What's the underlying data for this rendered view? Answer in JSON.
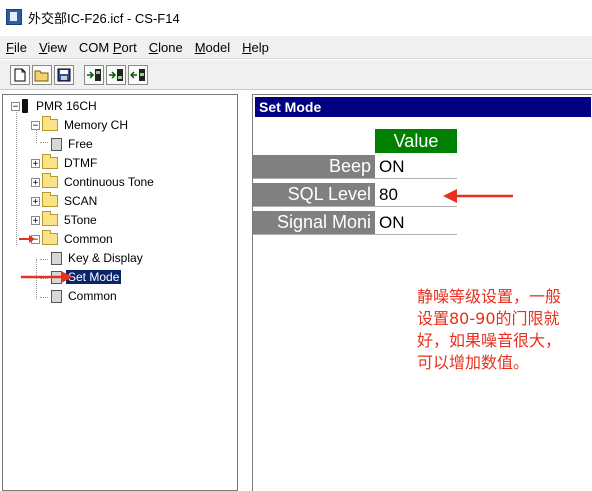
{
  "window": {
    "title": "外交部IC-F26.icf - CS-F14"
  },
  "menubar": {
    "items": [
      {
        "accel": "F",
        "rest": "ile"
      },
      {
        "accel": "V",
        "rest": "iew"
      },
      {
        "pre": "COM ",
        "accel": "P",
        "rest": "ort"
      },
      {
        "accel": "C",
        "rest": "lone"
      },
      {
        "accel": "M",
        "rest": "odel"
      },
      {
        "accel": "H",
        "rest": "elp"
      }
    ]
  },
  "toolbar": {
    "buttons": [
      "new-file-icon",
      "open-folder-icon",
      "save-icon",
      "read-radio-icon",
      "write-radio-icon",
      "clone-radio-icon"
    ]
  },
  "tree": {
    "nodes": [
      {
        "label": "PMR 16CH",
        "expander": "−"
      },
      {
        "label": "Memory CH",
        "expander": "−"
      },
      {
        "label": "Free"
      },
      {
        "label": "DTMF",
        "expander": "+"
      },
      {
        "label": "Continuous Tone",
        "expander": "+"
      },
      {
        "label": "SCAN",
        "expander": "+"
      },
      {
        "label": "5Tone",
        "expander": "+"
      },
      {
        "label": "Common",
        "expander": "−"
      },
      {
        "label": "Key & Display"
      },
      {
        "label": "Set Mode"
      },
      {
        "label": "Common"
      }
    ]
  },
  "panel": {
    "title": "Set Mode",
    "value_header": "Value",
    "rows": [
      {
        "label": "Beep",
        "value": "ON"
      },
      {
        "label": "SQL Level",
        "value": "80"
      },
      {
        "label": "Signal Moni",
        "value": "ON"
      }
    ]
  },
  "annotation": {
    "lines": [
      "静噪等级设置，一般",
      "设置80-90的门限就",
      "好，如果噪音很大，",
      "可以增加数值。"
    ]
  },
  "colors": {
    "panel_title_bg": "#000080",
    "value_header_bg": "#008000",
    "row_label_bg": "#808080",
    "annotation": "#e8301e",
    "selection_bg": "#0a246a"
  }
}
